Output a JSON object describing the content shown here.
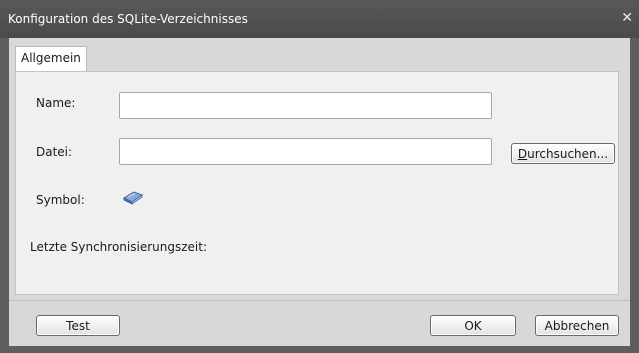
{
  "window": {
    "title": "Konfiguration des SQLite-Verzeichnisses",
    "close_glyph": "✕"
  },
  "tabs": [
    {
      "label": "Allgemein",
      "selected": true
    }
  ],
  "form": {
    "name_label": "Name:",
    "name_value": "",
    "file_label": "Datei:",
    "file_value": "",
    "browse_accel": "D",
    "browse_rest": "urchsuchen...",
    "symbol_label": "Symbol:",
    "symbol_icon": "book-icon",
    "sync_label": "Letzte Synchronisierungszeit:"
  },
  "buttons": {
    "test": "Test",
    "ok": "OK",
    "cancel": "Abbrechen"
  },
  "colors": {
    "titlebar": "#4e4e4e",
    "dialog_bg": "#d8d8d8",
    "panel_bg": "#f0f0f0",
    "icon_blue": "#5b7fc4"
  }
}
